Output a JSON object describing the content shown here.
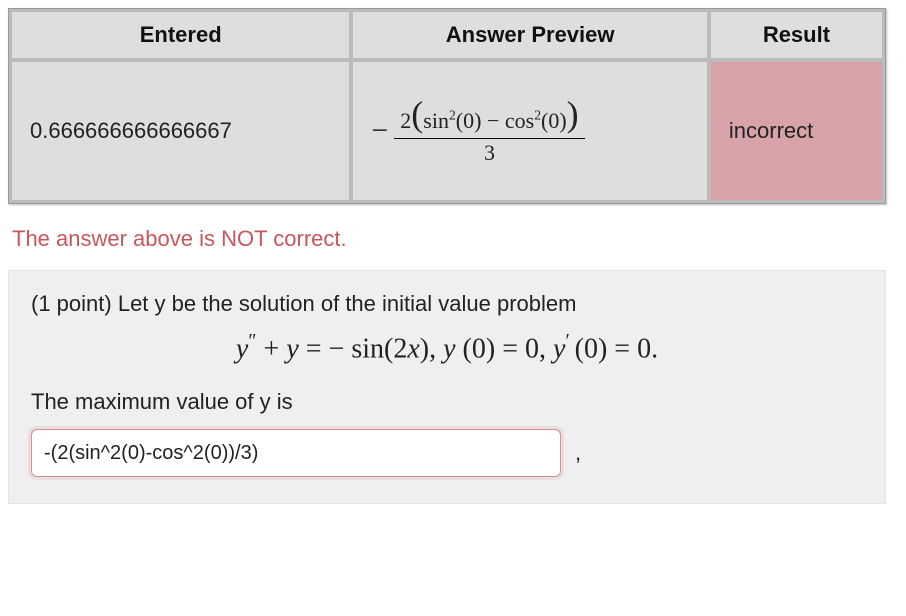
{
  "table": {
    "headers": {
      "entered": "Entered",
      "preview": "Answer Preview",
      "result": "Result"
    },
    "row": {
      "entered": "0.666666666666667",
      "preview": {
        "numerator_leading": "2",
        "term1_base": "sin",
        "term1_exp": "2",
        "term1_arg": "(0)",
        "minus": " − ",
        "term2_base": "cos",
        "term2_exp": "2",
        "term2_arg": "(0)",
        "denominator": "3",
        "leading_sign": "−"
      },
      "result": "incorrect"
    }
  },
  "feedback": "The answer above is NOT correct.",
  "problem": {
    "points_prefix": "(1 point) ",
    "intro": "Let y be the solution of the initial value problem",
    "equation": {
      "lhs_y": "y",
      "dprime": "″",
      "plus": " + ",
      "y2": "y",
      "eq": " = ",
      "neg": "− ",
      "sin": "sin(2",
      "x": "x",
      "closeparen": "), ",
      "ic1_y": "y ",
      "ic1_arg": "(0) = 0, ",
      "ic2_y": "y",
      "prime": "′ ",
      "ic2_arg": "(0) = 0."
    },
    "prompt": "The maximum value of y is",
    "input_value": "-(2(sin^2(0)-cos^2(0))/3)",
    "trailing_comma": ","
  }
}
